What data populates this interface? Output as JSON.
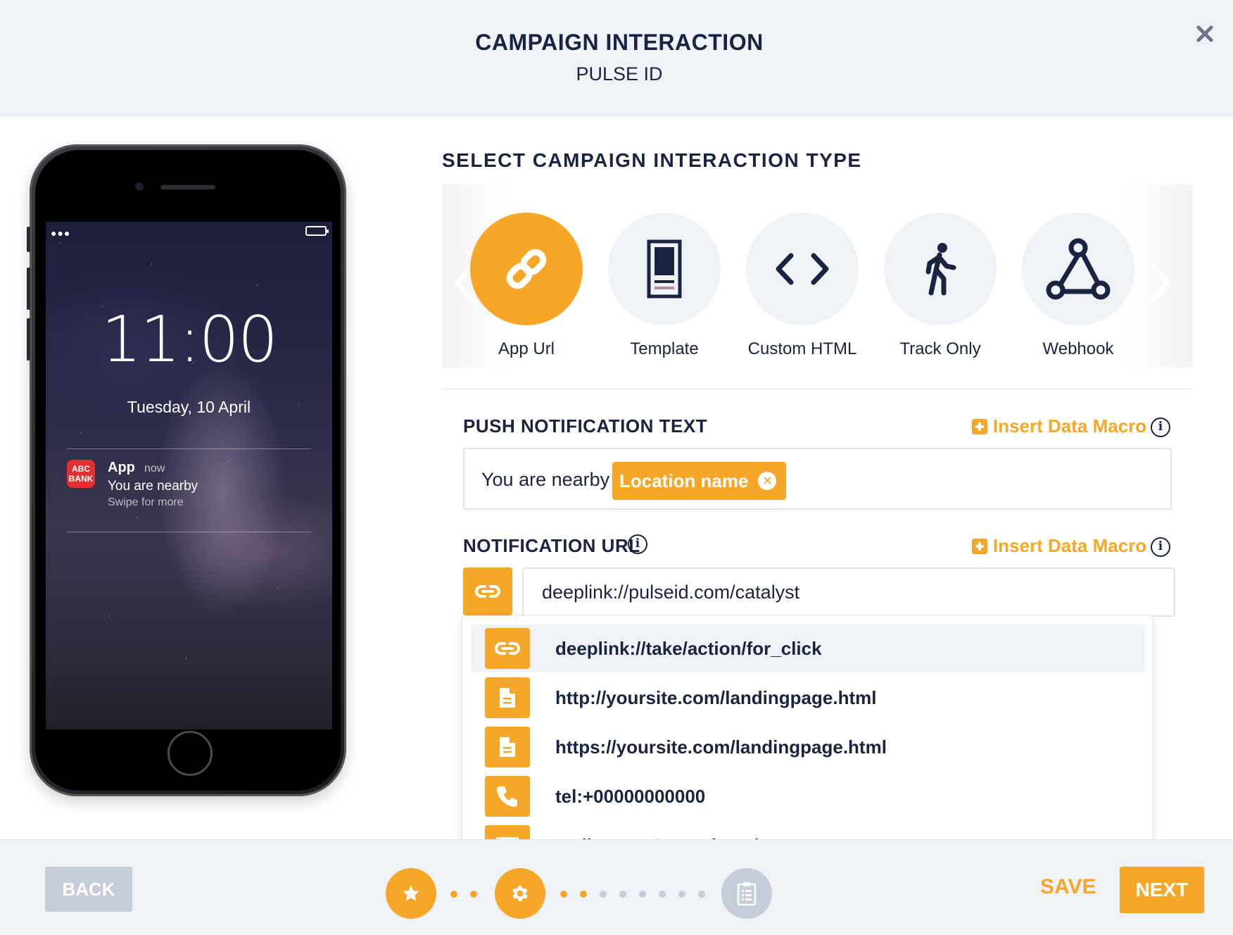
{
  "header": {
    "title": "CAMPAIGN INTERACTION",
    "subtitle": "PULSE ID"
  },
  "phone": {
    "clock": "11:00",
    "date": "Tuesday, 10 April",
    "notification": {
      "app_icon_text": "ABC BANK",
      "app_name": "App",
      "time": "now",
      "message": "You are nearby",
      "hint": "Swipe for more"
    }
  },
  "interaction": {
    "section_title": "SELECT CAMPAIGN INTERACTION TYPE",
    "types": [
      {
        "label": "App Url",
        "icon": "link-icon",
        "selected": true
      },
      {
        "label": "Template",
        "icon": "template-icon",
        "selected": false
      },
      {
        "label": "Custom HTML",
        "icon": "code-icon",
        "selected": false
      },
      {
        "label": "Track Only",
        "icon": "walking-person-icon",
        "selected": false
      },
      {
        "label": "Webhook",
        "icon": "webhook-icon",
        "selected": false
      }
    ]
  },
  "push": {
    "label": "PUSH NOTIFICATION TEXT",
    "macro_label": "Insert Data Macro",
    "text": "You are nearby",
    "macro_chip": "Location name"
  },
  "url": {
    "label": "NOTIFICATION URL",
    "macro_label": "Insert Data Macro",
    "value": "deeplink://pulseid.com/catalyst",
    "suggestions": [
      {
        "icon": "link-icon",
        "text": "deeplink://take/action/for_click",
        "highlighted": true
      },
      {
        "icon": "document-icon",
        "text": "http://yoursite.com/landingpage.html",
        "highlighted": false
      },
      {
        "icon": "document-icon",
        "text": "https://yoursite.com/landingpage.html",
        "highlighted": false
      },
      {
        "icon": "phone-icon",
        "text": "tel:+00000000000",
        "highlighted": false
      },
      {
        "icon": "envelope-icon",
        "text": "mailto:you@yourdomain.com",
        "highlighted": false
      }
    ]
  },
  "footer": {
    "back_label": "BACK",
    "save_label": "SAVE",
    "next_label": "NEXT",
    "steps": [
      {
        "icon": "star-icon",
        "status": "done"
      },
      {
        "icon": "gear-icon",
        "status": "current"
      },
      {
        "icon": "clipboard-icon",
        "status": "upcoming"
      }
    ]
  },
  "colors": {
    "accent": "#f7a727",
    "navy": "#1a2440",
    "panel": "#eff2f7",
    "disabled": "#c5cdd8"
  }
}
